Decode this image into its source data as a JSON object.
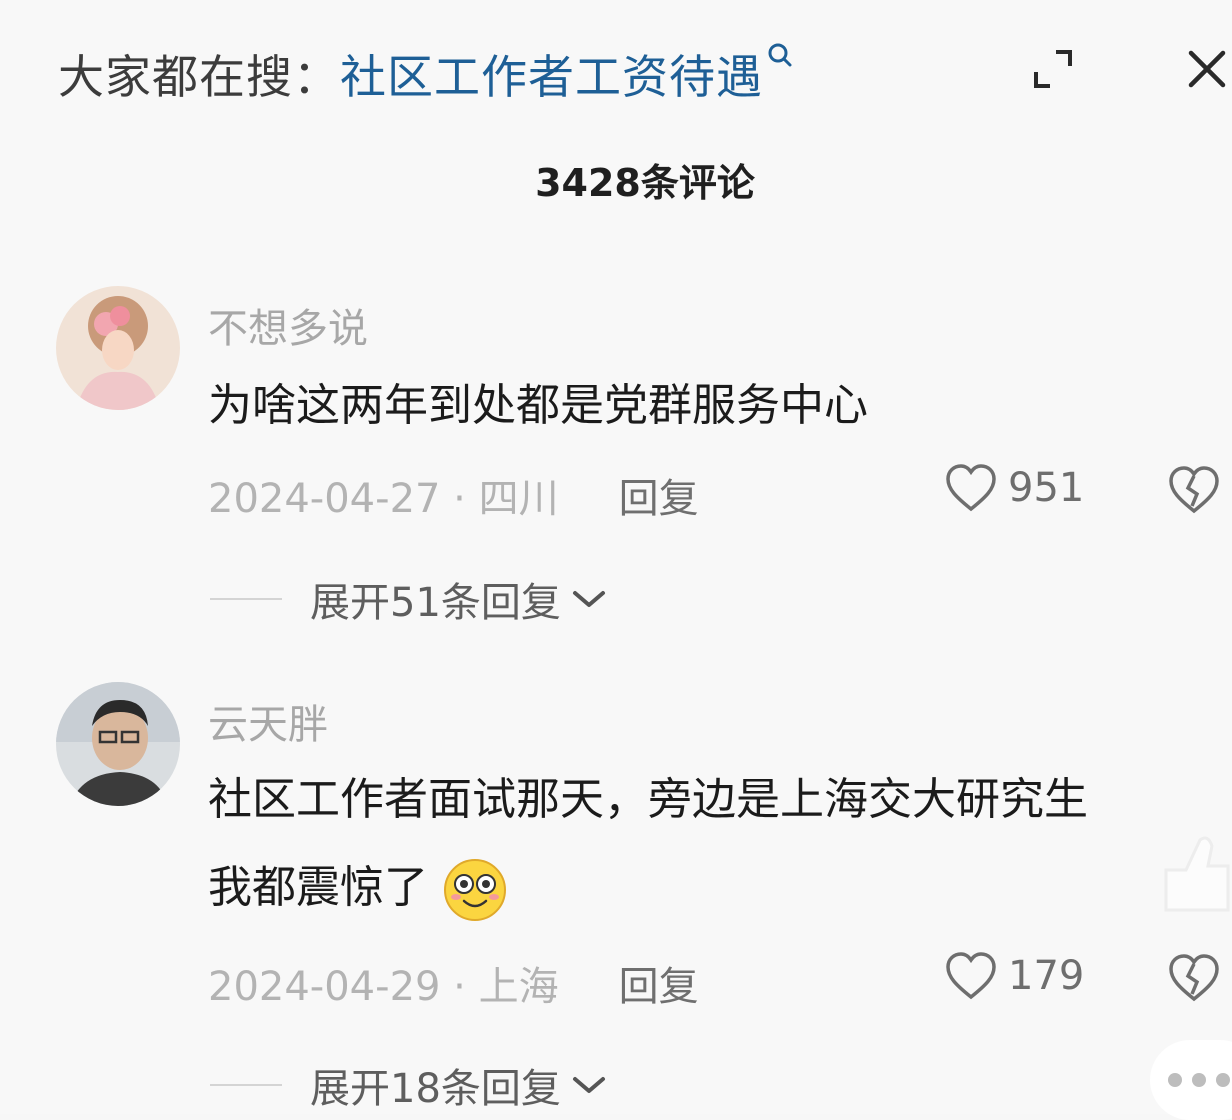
{
  "header": {
    "search_prefix": "大家都在搜：",
    "search_term": "社区工作者工资待遇",
    "comment_count": "3428条评论"
  },
  "comments": [
    {
      "username": "不想多说",
      "text": "为啥这两年到处都是党群服务中心",
      "date": "2024-04-27 · 四川",
      "reply_label": "回复",
      "likes": "951",
      "expand_label": "展开51条回复"
    },
    {
      "username": "云天胖",
      "text": "社区工作者面试那天，旁边是上海交大研究生",
      "text_tail": "我都震惊了",
      "date": "2024-04-29 · 上海",
      "reply_label": "回复",
      "likes": "179",
      "expand_label": "展开18条回复"
    }
  ],
  "icons": {
    "search": "search-icon",
    "expand": "expand-icon",
    "close": "close-icon",
    "heart": "heart-icon",
    "broken_heart": "broken-heart-icon",
    "chevron": "chevron-down-icon",
    "emoji": "smiling-face-emoji"
  },
  "colors": {
    "search_term": "#1e5f96",
    "background": "#f8f8f8"
  }
}
